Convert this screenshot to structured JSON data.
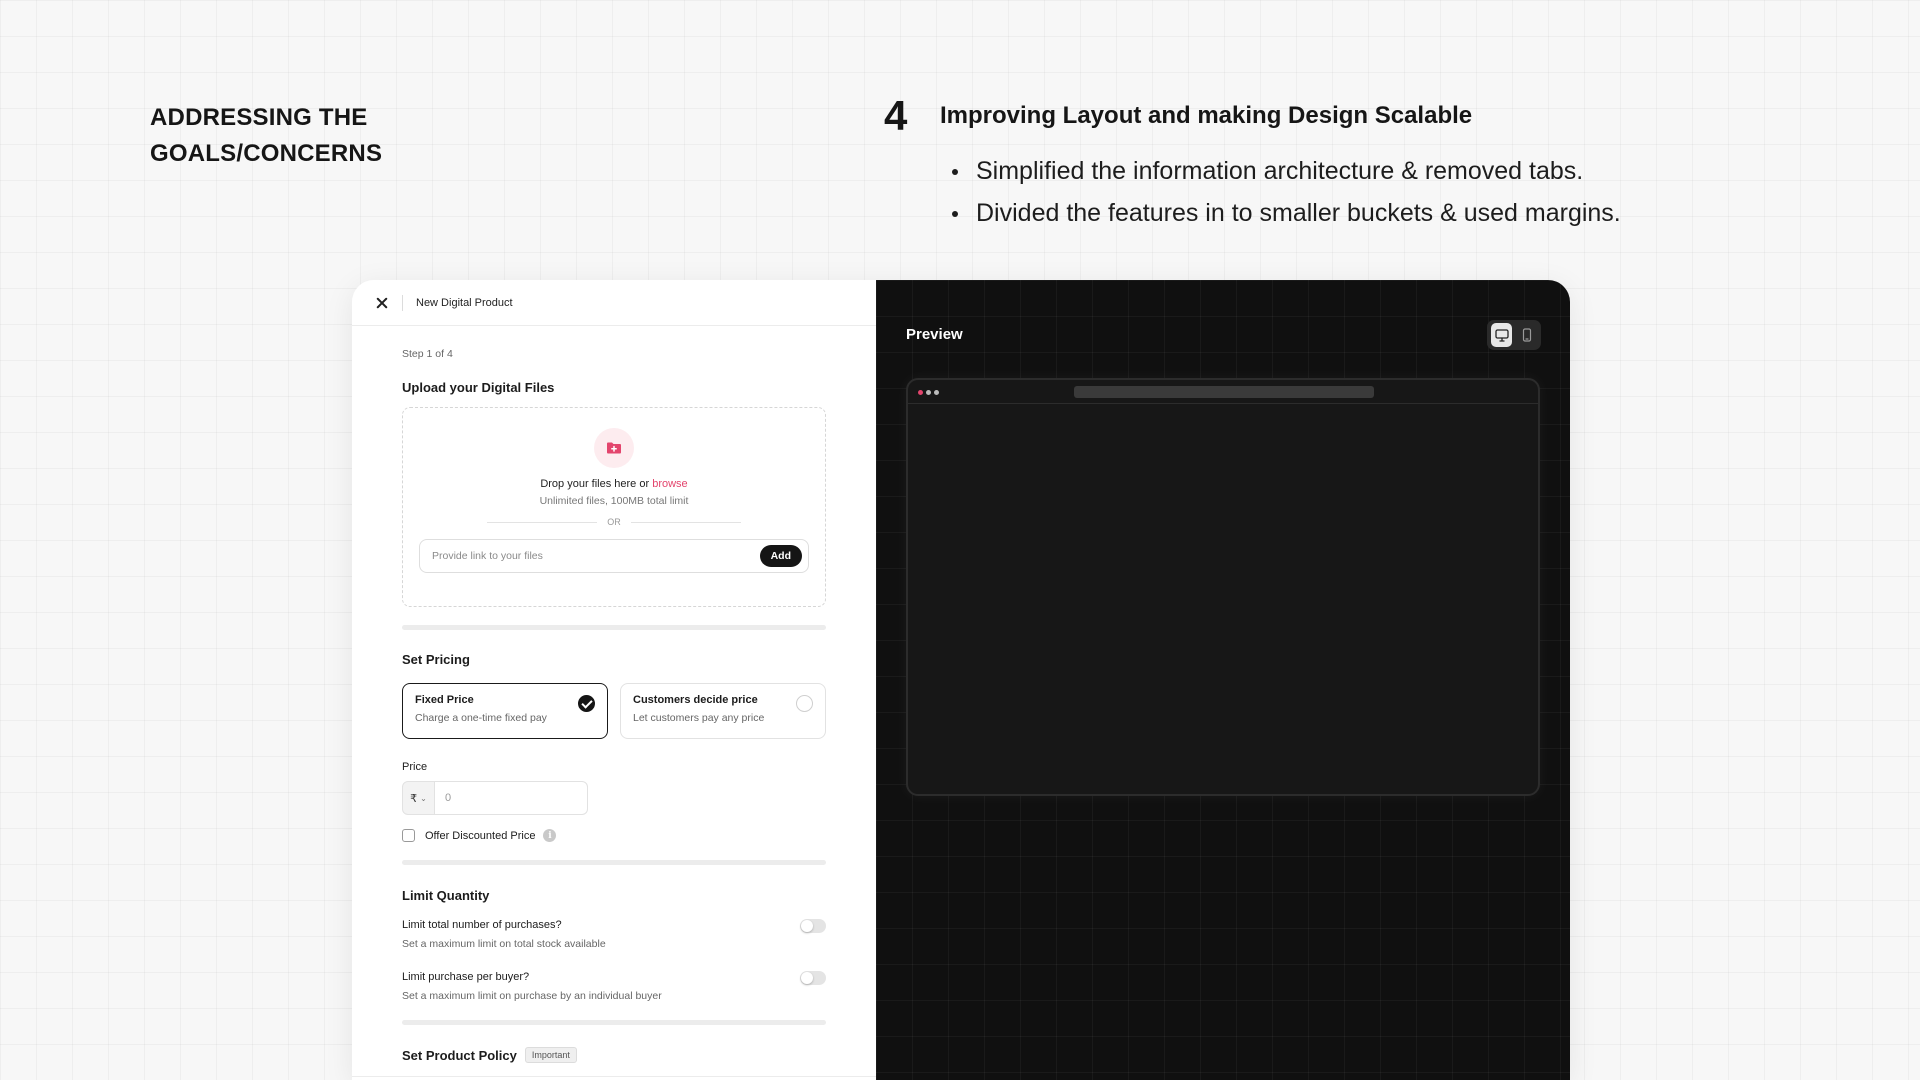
{
  "slide": {
    "left_heading_line1": "ADDRESSING THE",
    "left_heading_line2": "GOALS/CONCERNS",
    "section_number": "4",
    "section_title": "Improving Layout and making Design Scalable",
    "bullets": [
      "Simplified the information architecture & removed tabs.",
      "Divided the features in to smaller buckets & used margins."
    ]
  },
  "form": {
    "topbar_title": "New Digital Product",
    "step": "Step 1 of 4",
    "upload": {
      "heading": "Upload your Digital Files",
      "drop_text": "Drop your files here or",
      "browse": "browse",
      "limit": "Unlimited files, 100MB total limit",
      "or": "OR",
      "link_placeholder": "Provide link to your files",
      "add_button": "Add"
    },
    "pricing": {
      "heading": "Set Pricing",
      "options": [
        {
          "title": "Fixed Price",
          "desc": "Charge a one-time fixed pay",
          "selected": true
        },
        {
          "title": "Customers decide price",
          "desc": "Let customers pay any price",
          "selected": false
        }
      ],
      "price_label": "Price",
      "currency": "₹",
      "price_placeholder": "0",
      "discount_label": "Offer Discounted Price",
      "info_glyph": "i"
    },
    "limits": {
      "heading": "Limit Quantity",
      "items": [
        {
          "title": "Limit total number of purchases?",
          "desc": "Set a maximum limit on total stock available"
        },
        {
          "title": "Limit purchase per buyer?",
          "desc": "Set a maximum limit on purchase by an individual buyer"
        }
      ]
    },
    "policy": {
      "heading": "Set Product Policy",
      "badge": "Important"
    }
  },
  "preview": {
    "title": "Preview",
    "active_device": "desktop",
    "icons": [
      "desktop-icon",
      "mobile-icon"
    ],
    "accent_color": "#e3456d"
  }
}
